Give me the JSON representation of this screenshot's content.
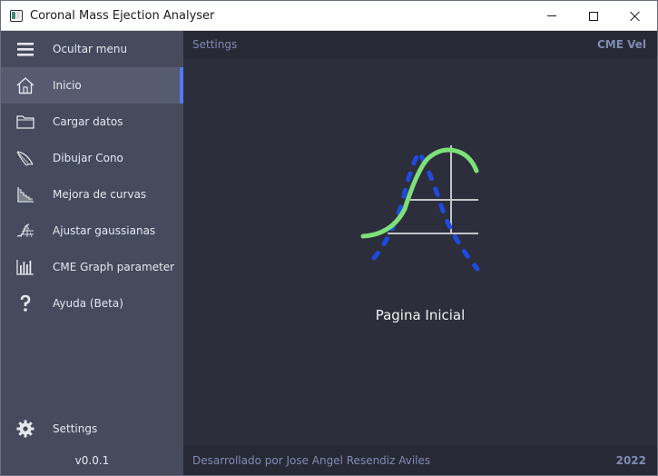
{
  "window": {
    "title": "Coronal Mass Ejection Analyser",
    "controls": [
      "minimize-icon",
      "maximize-icon",
      "close-icon"
    ]
  },
  "sidebar": {
    "items": [
      {
        "label": "Ocultar menu",
        "icon": "hamburger-menu-icon",
        "active": false
      },
      {
        "label": "Inicio",
        "icon": "home-icon",
        "active": true
      },
      {
        "label": "Cargar datos",
        "icon": "folder-icon",
        "active": false
      },
      {
        "label": "Dibujar Cono",
        "icon": "cone-icon",
        "active": false
      },
      {
        "label": "Mejora de curvas",
        "icon": "curve-fit-icon",
        "active": false
      },
      {
        "label": "Ajustar gaussianas",
        "icon": "gaussian-icon",
        "active": false
      },
      {
        "label": "CME Graph parameter",
        "icon": "bar-graph-icon",
        "active": false
      },
      {
        "label": "Ayuda (Beta)",
        "icon": "help-icon",
        "active": false
      }
    ],
    "settings": {
      "label": "Settings",
      "icon": "gear-icon"
    },
    "version": "v0.0.1"
  },
  "topbar": {
    "breadcrumb": "Settings",
    "right_label": "CME Vel"
  },
  "main": {
    "hero_icon": "gaussian-curve-logo",
    "title": "Pagina Inicial"
  },
  "footer": {
    "credit": "Desarrollado por Jose Angel Resendiz Aviles",
    "year": "2022"
  },
  "colors": {
    "sidebar_bg": "#464a5d",
    "sidebar_active": "#565b6f",
    "accent": "#4f7cf5",
    "main_bg": "#2c2f3b",
    "bar_bg": "#272a35",
    "muted_text": "#7f8bb3",
    "curve_green": "#7ee07a",
    "curve_blue": "#1f49e0"
  }
}
